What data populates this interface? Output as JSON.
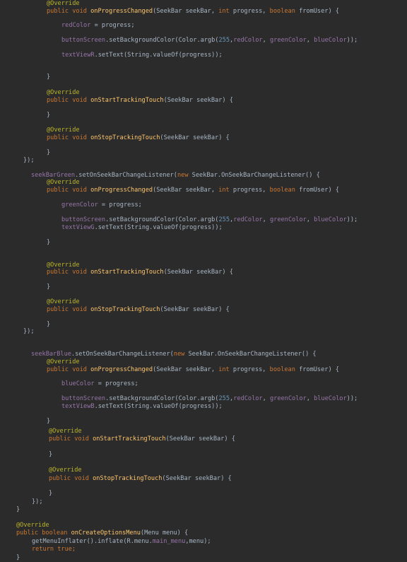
{
  "colors": {
    "background": "#2b2b2b",
    "plain": "#a9b7c6",
    "keyword": "#cc7832",
    "annotation": "#bbb529",
    "method": "#ffc66d",
    "field": "#9876aa",
    "number": "#6897bb"
  },
  "code_lines": [
    [
      [
        "ann",
        "@Override"
      ]
    ],
    [
      [
        "kw",
        "public void "
      ],
      [
        "fn",
        "onProgressChanged"
      ],
      [
        "pl",
        "(SeekBar seekBar, "
      ],
      [
        "kw",
        "int "
      ],
      [
        "pl",
        "progress, "
      ],
      [
        "kw",
        "boolean "
      ],
      [
        "pl",
        "fromUser) {"
      ]
    ],
    [
      [
        "fld",
        "redColor"
      ],
      [
        "pl",
        " = progress;"
      ]
    ],
    [
      [
        "fld",
        "buttonScreen"
      ],
      [
        "pl",
        ".setBackgroundColor(Color.argb("
      ],
      [
        "num",
        "255"
      ],
      [
        "pl",
        ","
      ],
      [
        "fld",
        "redColor"
      ],
      [
        "pl",
        ", "
      ],
      [
        "fld",
        "greenColor"
      ],
      [
        "pl",
        ", "
      ],
      [
        "fld",
        "blueColor"
      ],
      [
        "pl",
        "));"
      ]
    ],
    [
      [
        "fld",
        "textViewR"
      ],
      [
        "pl",
        ".setText(String.valueOf(progress));"
      ]
    ],
    [
      [
        "pl",
        "}"
      ]
    ],
    [
      [
        "ann",
        "@Override"
      ]
    ],
    [
      [
        "kw",
        "public void "
      ],
      [
        "fn",
        "onStartTrackingTouch"
      ],
      [
        "pl",
        "(SeekBar seekBar) {"
      ]
    ],
    [
      [
        "pl",
        "}"
      ]
    ],
    [
      [
        "ann",
        "@Override"
      ]
    ],
    [
      [
        "kw",
        "public void "
      ],
      [
        "fn",
        "onStopTrackingTouch"
      ],
      [
        "pl",
        "(SeekBar seekBar) {"
      ]
    ],
    [
      [
        "pl",
        "}"
      ]
    ],
    [
      [
        "pl",
        "});"
      ]
    ],
    [
      [
        "fld",
        "seekBarGreen"
      ],
      [
        "pl",
        ".setOnSeekBarChangeListener("
      ],
      [
        "kw",
        "new "
      ],
      [
        "pl",
        "SeekBar.OnSeekBarChangeListener() {"
      ]
    ],
    [
      [
        "ann",
        "@Override"
      ]
    ],
    [
      [
        "kw",
        "public void "
      ],
      [
        "fn",
        "onProgressChanged"
      ],
      [
        "pl",
        "(SeekBar seekBar, "
      ],
      [
        "kw",
        "int "
      ],
      [
        "pl",
        "progress, "
      ],
      [
        "kw",
        "boolean "
      ],
      [
        "pl",
        "fromUser) {"
      ]
    ],
    [
      [
        "fld",
        "greenColor"
      ],
      [
        "pl",
        " = progress;"
      ]
    ],
    [
      [
        "fld",
        "buttonScreen"
      ],
      [
        "pl",
        ".setBackgroundColor(Color.argb("
      ],
      [
        "num",
        "255"
      ],
      [
        "pl",
        ","
      ],
      [
        "fld",
        "redColor"
      ],
      [
        "pl",
        ", "
      ],
      [
        "fld",
        "greenColor"
      ],
      [
        "pl",
        ", "
      ],
      [
        "fld",
        "blueColor"
      ],
      [
        "pl",
        "));"
      ]
    ],
    [
      [
        "fld",
        "textViewG"
      ],
      [
        "pl",
        ".setText(String.valueOf(progress));"
      ]
    ],
    [
      [
        "pl",
        "}"
      ]
    ],
    [
      [
        "ann",
        "@Override"
      ]
    ],
    [
      [
        "kw",
        "public void "
      ],
      [
        "fn",
        "onStartTrackingTouch"
      ],
      [
        "pl",
        "(SeekBar seekBar) {"
      ]
    ],
    [
      [
        "pl",
        "}"
      ]
    ],
    [
      [
        "ann",
        "@Override"
      ]
    ],
    [
      [
        "kw",
        "public void "
      ],
      [
        "fn",
        "onStopTrackingTouch"
      ],
      [
        "pl",
        "(SeekBar seekBar) {"
      ]
    ],
    [
      [
        "pl",
        "}"
      ]
    ],
    [
      [
        "pl",
        "});"
      ]
    ],
    [
      [
        "fld",
        "seekBarBlue"
      ],
      [
        "pl",
        ".setOnSeekBarChangeListener("
      ],
      [
        "kw",
        "new "
      ],
      [
        "pl",
        "SeekBar.OnSeekBarChangeListener() {"
      ]
    ],
    [
      [
        "ann",
        "@Override"
      ]
    ],
    [
      [
        "kw",
        "public void "
      ],
      [
        "fn",
        "onProgressChanged"
      ],
      [
        "pl",
        "(SeekBar seekBar, "
      ],
      [
        "kw",
        "int "
      ],
      [
        "pl",
        "progress, "
      ],
      [
        "kw",
        "boolean "
      ],
      [
        "pl",
        "fromUser) {"
      ]
    ],
    [
      [
        "fld",
        "blueColor"
      ],
      [
        "pl",
        " = progress;"
      ]
    ],
    [
      [
        "fld",
        "buttonScreen"
      ],
      [
        "pl",
        ".setBackgroundColor(Color.argb("
      ],
      [
        "num",
        "255"
      ],
      [
        "pl",
        ","
      ],
      [
        "fld",
        "redColor"
      ],
      [
        "pl",
        ", "
      ],
      [
        "fld",
        "greenColor"
      ],
      [
        "pl",
        ", "
      ],
      [
        "fld",
        "blueColor"
      ],
      [
        "pl",
        "));"
      ]
    ],
    [
      [
        "fld",
        "textViewB"
      ],
      [
        "pl",
        ".setText(String.valueOf(progress));"
      ]
    ],
    [
      [
        "pl",
        "}"
      ]
    ],
    [
      [
        "ann",
        "@Override"
      ]
    ],
    [
      [
        "kw",
        "public void "
      ],
      [
        "fn",
        "onStartTrackingTouch"
      ],
      [
        "pl",
        "(SeekBar seekBar) {"
      ]
    ],
    [
      [
        "pl",
        "}"
      ]
    ],
    [
      [
        "ann",
        "@Override"
      ]
    ],
    [
      [
        "kw",
        "public void "
      ],
      [
        "fn",
        "onStopTrackingTouch"
      ],
      [
        "pl",
        "(SeekBar seekBar) {"
      ]
    ],
    [
      [
        "pl",
        "}"
      ]
    ],
    [
      [
        "pl",
        "});"
      ]
    ],
    [
      [
        "pl",
        "}"
      ]
    ],
    [
      [
        "ann",
        "@Override"
      ]
    ],
    [
      [
        "kw",
        "public boolean "
      ],
      [
        "fn",
        "onCreateOptionsMenu"
      ],
      [
        "pl",
        "(Menu menu) {"
      ]
    ],
    [
      [
        "pl",
        "getMenuInflater().inflate(R.menu."
      ],
      [
        "fld",
        "main_menu"
      ],
      [
        "pl",
        ",menu);"
      ]
    ],
    [
      [
        "kw",
        "return true;"
      ]
    ],
    [
      [
        "pl",
        "}"
      ]
    ]
  ]
}
